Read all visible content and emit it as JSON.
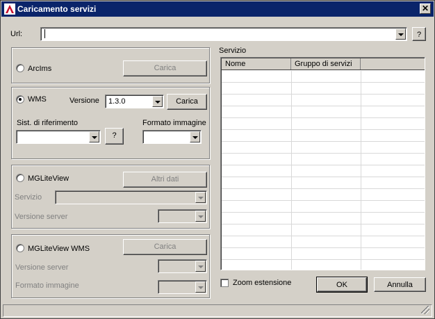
{
  "window": {
    "title": "Caricamento servizi",
    "close_label": "✕"
  },
  "url": {
    "label": "Url:",
    "value": "",
    "help_label": "?"
  },
  "arcims": {
    "label": "ArcIms",
    "load_label": "Carica"
  },
  "wms": {
    "label": "WMS",
    "version_label": "Versione",
    "version_value": "1.3.0",
    "load_label": "Carica",
    "srs_label": "Sist. di riferimento",
    "srs_value": "",
    "srs_help_label": "?",
    "image_format_label": "Formato immagine",
    "image_format_value": ""
  },
  "mgliteview": {
    "label": "MGLiteView",
    "more_label": "Altri dati",
    "service_label": "Servizio",
    "server_version_label": "Versione server"
  },
  "mgliteview_wms": {
    "label": "MGLiteView WMS",
    "load_label": "Carica",
    "server_version_label": "Versione server",
    "image_format_label": "Formato immagine"
  },
  "services": {
    "title": "Servizio",
    "columns": [
      "Nome",
      "Gruppo di servizi",
      ""
    ]
  },
  "zoom_extent_label": "Zoom estensione",
  "ok_label": "OK",
  "cancel_label": "Annulla"
}
